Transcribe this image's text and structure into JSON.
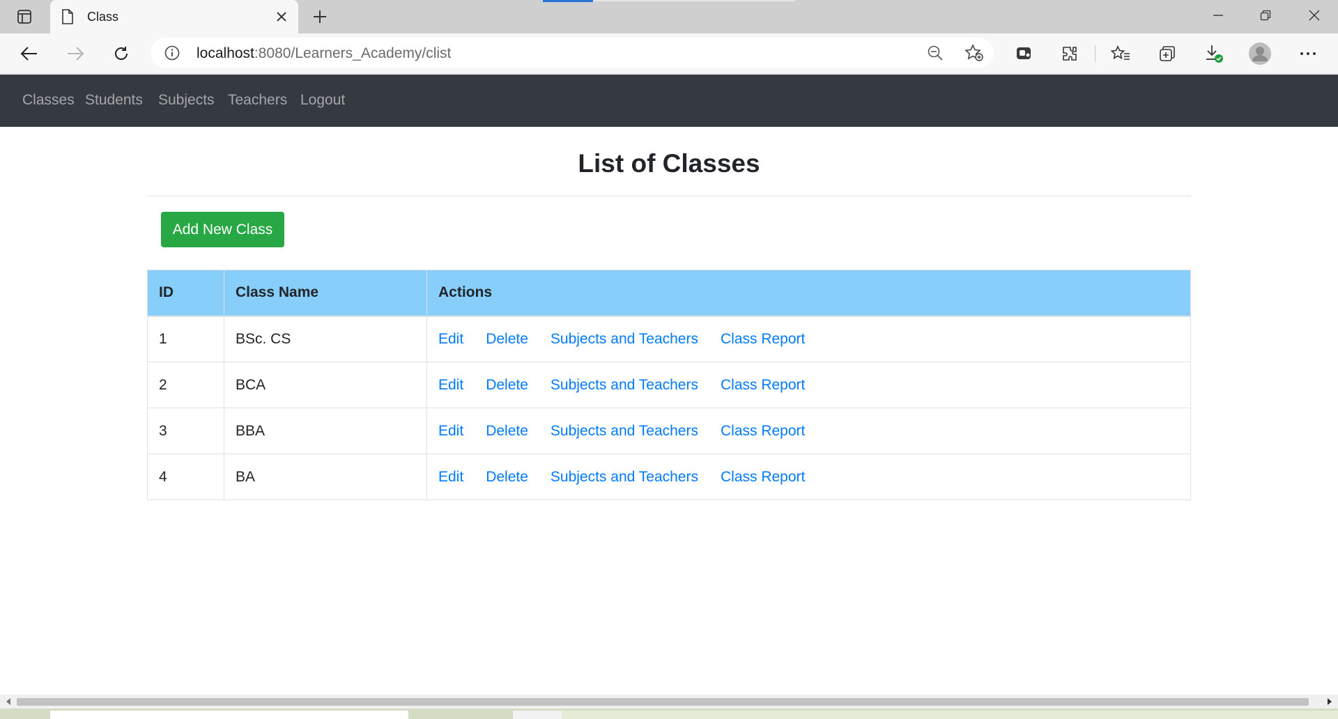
{
  "browser": {
    "tab_title": "Class",
    "url_host": "localhost",
    "url_path": ":8080/Learners_Academy/clist",
    "tab_loading_progress": 0.2
  },
  "navbar": {
    "links": [
      "Classes",
      "Students",
      "Subjects",
      "Teachers",
      "Logout"
    ]
  },
  "page": {
    "title": "List of Classes",
    "add_button": "Add New Class"
  },
  "table": {
    "headers": [
      "ID",
      "Class Name",
      "Actions"
    ],
    "rows": [
      {
        "id": "1",
        "name": "BSc. CS"
      },
      {
        "id": "2",
        "name": "BCA"
      },
      {
        "id": "3",
        "name": "BBA"
      },
      {
        "id": "4",
        "name": "BA"
      }
    ],
    "actions": [
      "Edit",
      "Delete",
      "Subjects and Teachers",
      "Class Report"
    ]
  },
  "colors": {
    "navbar_bg": "#343a40",
    "header_bg": "#87cefa",
    "link": "#007bff",
    "add_button_bg": "#28a745"
  }
}
